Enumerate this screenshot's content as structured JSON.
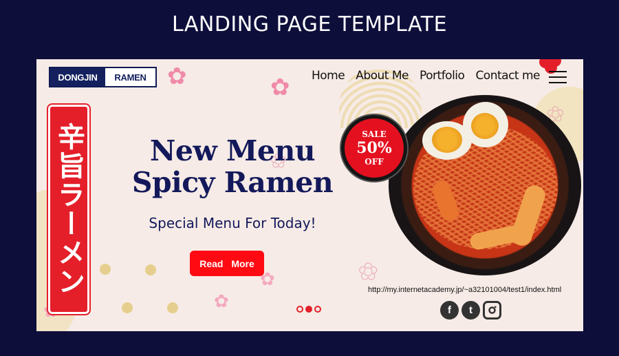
{
  "page_heading": "LANDING PAGE  TEMPLATE",
  "logo": {
    "left": "DONGJIN",
    "right": "RAMEN"
  },
  "nav": {
    "items": [
      "Home",
      "About Me",
      "Portfolio",
      "Contact me"
    ]
  },
  "vertical_sign": "辛旨ラーメン",
  "hero": {
    "headline_line1": "New Menu",
    "headline_line2": "Spicy Ramen",
    "subtitle": "Special Menu For Today!",
    "cta_label": "Read  More"
  },
  "sale_badge": {
    "label": "SALE",
    "percent": "50%",
    "off": "OFF"
  },
  "url": "http://my.internetacademy.jp/~a32101004/test1/index.html",
  "social": {
    "facebook": "f",
    "twitter": "t",
    "instagram": "◎"
  },
  "slider": {
    "count": 3,
    "active_index": 1
  },
  "colors": {
    "accent": "#e41f2a",
    "navy": "#13195a",
    "background": "#f6ebe6",
    "outer": "#0d0e3a"
  },
  "icons": [
    "menu-icon",
    "facebook-icon",
    "twitter-icon",
    "instagram-icon",
    "sakura-icon"
  ]
}
